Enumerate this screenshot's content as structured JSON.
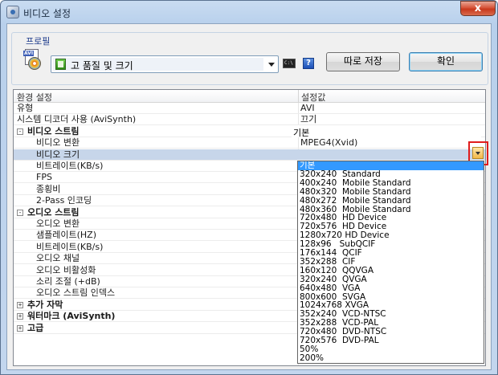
{
  "window": {
    "title": "비디오 설정",
    "close_label": "x"
  },
  "profile": {
    "group_label": "프로필",
    "selected": "고 품질 및 크기",
    "save_button": "따로 저장",
    "ok_button": "확인",
    "cmd_icon_text": "C:\\",
    "help_icon_text": "?"
  },
  "grid": {
    "headers": [
      "환경 설정",
      "설정값"
    ],
    "rows": [
      {
        "name": "유형",
        "value": "AVI",
        "indent": 0
      },
      {
        "name": "시스템 디코더 사용 (AviSynth)",
        "value": "끄기",
        "indent": 0
      },
      {
        "name": "비디오 스트림",
        "value": "",
        "category": true,
        "expander": "-"
      },
      {
        "name": "비디오 변환",
        "value": "MPEG4(Xvid)",
        "indent": 1
      },
      {
        "name": "비디오 크기",
        "value": "기본",
        "indent": 1,
        "selected": true
      },
      {
        "name": "비트레이트(KB/s)",
        "value": "",
        "indent": 1
      },
      {
        "name": "FPS",
        "value": "",
        "indent": 1
      },
      {
        "name": "종횡비",
        "value": "",
        "indent": 1
      },
      {
        "name": "2-Pass 인코딩",
        "value": "",
        "indent": 1
      },
      {
        "name": "오디오 스트림",
        "value": "",
        "category": true,
        "expander": "-"
      },
      {
        "name": "오디오 변환",
        "value": "",
        "indent": 1
      },
      {
        "name": "샘플레이트(HZ)",
        "value": "",
        "indent": 1
      },
      {
        "name": "비트레이트(KB/s)",
        "value": "",
        "indent": 1
      },
      {
        "name": "오디오 채널",
        "value": "",
        "indent": 1
      },
      {
        "name": "오디오 비활성화",
        "value": "",
        "indent": 1
      },
      {
        "name": "소리 조절 (+dB)",
        "value": "",
        "indent": 1
      },
      {
        "name": "오디오 스트림 인덱스",
        "value": "",
        "indent": 1
      },
      {
        "name": "추가 자막",
        "value": "",
        "category": true,
        "expander": "+"
      },
      {
        "name": "워터마크 (AviSynth)",
        "value": "",
        "category": true,
        "expander": "+"
      },
      {
        "name": "고급",
        "value": "",
        "category": true,
        "expander": "+"
      }
    ]
  },
  "size_dropdown": {
    "current": "기본",
    "options": [
      "기본",
      "320x240  Standard",
      "400x240  Mobile Standard",
      "480x320  Mobile Standard",
      "480x272  Mobile Standard",
      "480x360  Mobile Standard",
      "720x480  HD Device",
      "720x576  HD Device",
      "1280x720 HD Device",
      "128x96   SubQCIF",
      "176x144  QCIF",
      "352x288  CIF",
      "160x120  QQVGA",
      "320x240  QVGA",
      "640x480  VGA",
      "800x600  SVGA",
      "1024x768 XVGA",
      "352x240  VCD-NTSC",
      "352x288  VCD-PAL",
      "720x480  DVD-NTSC",
      "720x576  DVD-PAL",
      "50%",
      "200%"
    ]
  }
}
